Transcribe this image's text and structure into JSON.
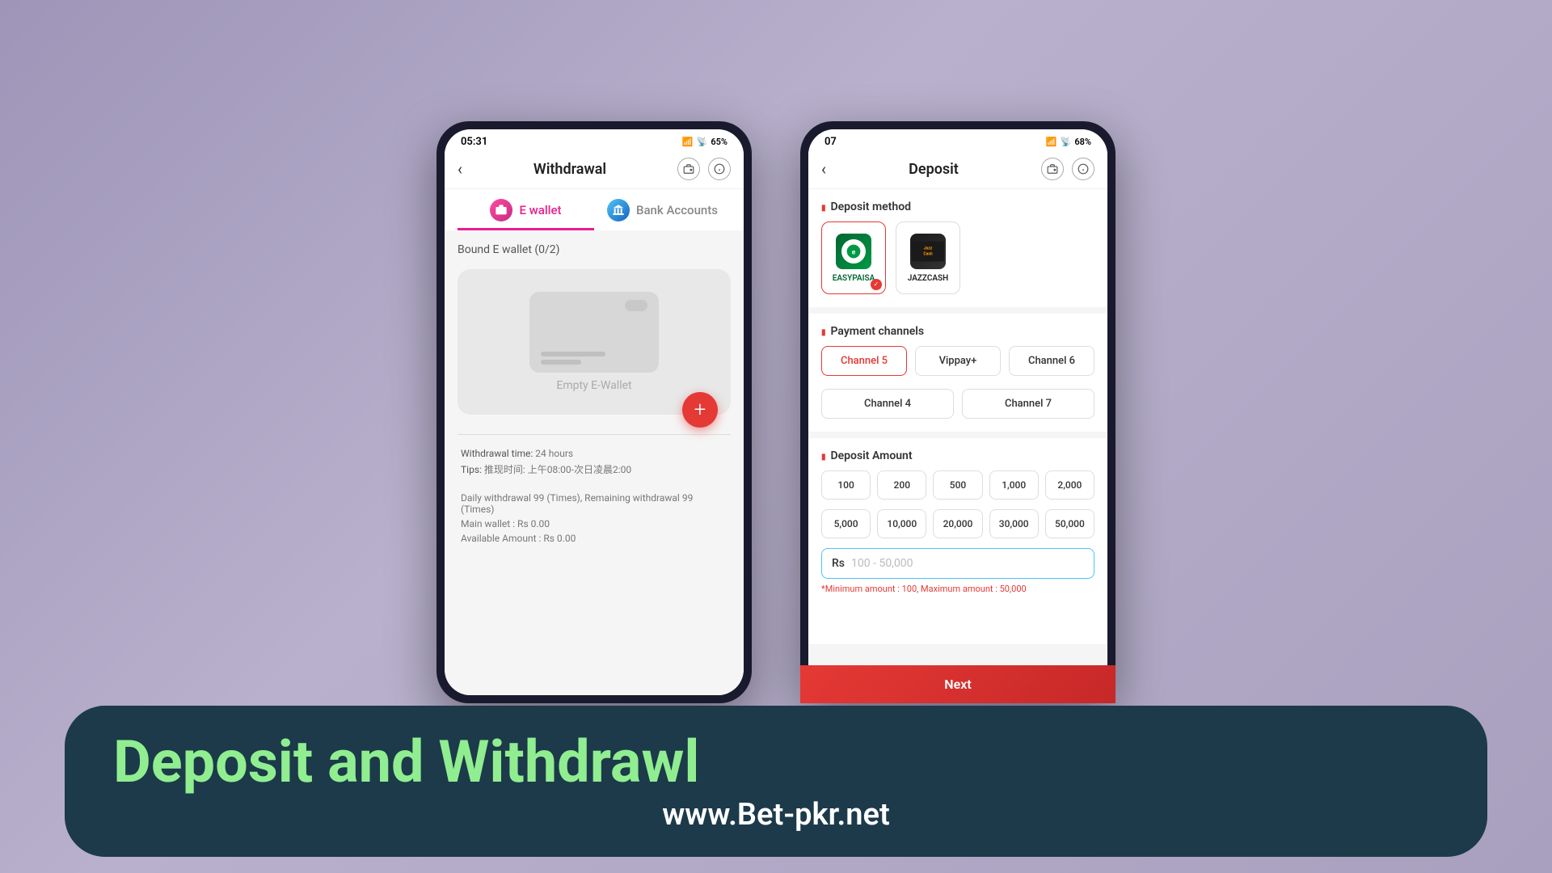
{
  "page": {
    "background_color": "#b0a8c8"
  },
  "phone_left": {
    "status_bar": {
      "time": "05:31",
      "wifi": "WiFi",
      "signal": "Signal",
      "battery": "65%"
    },
    "header": {
      "back_label": "‹",
      "title": "Withdrawal",
      "wallet_icon": "wallet",
      "info_icon": "ℹ"
    },
    "tabs": [
      {
        "id": "ewallet",
        "label": "E wallet",
        "active": true
      },
      {
        "id": "bank",
        "label": "Bank Accounts",
        "active": false
      }
    ],
    "bound_label": "Bound E wallet (0/2)",
    "empty_wallet_text": "Empty E-Wallet",
    "add_button_label": "+",
    "info": {
      "withdrawal_time_label": "Withdrawal time:",
      "withdrawal_time_value": "24 hours",
      "tips_label": "Tips:",
      "tips_value": "推现时间: 上午08:00-次日凌晨2:00",
      "daily_label": "Daily withdrawal 99 (Times), Remaining withdrawal 99 (Times)",
      "main_wallet_label": "Main wallet : Rs 0.00",
      "available_label": "Available Amount : Rs 0.00"
    }
  },
  "phone_right": {
    "status_bar": {
      "time": "07",
      "wifi": "WiFi",
      "signal": "Signal",
      "battery": "68%"
    },
    "header": {
      "back_label": "‹",
      "title": "Deposit",
      "wallet_icon": "wallet",
      "info_icon": "ℹ"
    },
    "deposit_method_title": "Deposit method",
    "payment_methods": [
      {
        "id": "easypaisa",
        "label": "EASYPAISA",
        "selected": true
      },
      {
        "id": "jazzcash",
        "label": "JAZZCASH",
        "selected": false
      }
    ],
    "payment_channels_title": "Payment channels",
    "channels_row1": [
      {
        "id": "ch5",
        "label": "Channel 5",
        "selected": true
      },
      {
        "id": "vippay",
        "label": "Vippay+",
        "selected": false
      },
      {
        "id": "ch6",
        "label": "Channel 6",
        "selected": false
      }
    ],
    "channels_row2": [
      {
        "id": "ch4",
        "label": "Channel 4",
        "selected": false
      },
      {
        "id": "ch7",
        "label": "Channel 7",
        "selected": false
      }
    ],
    "deposit_amount_title": "Deposit Amount",
    "amounts_row1": [
      "100",
      "200",
      "500",
      "1,000",
      "2,000"
    ],
    "amounts_row2": [
      "5,000",
      "10,000",
      "20,000",
      "30,000",
      "50,000"
    ],
    "amount_input": {
      "currency": "Rs",
      "placeholder": "100 - 50,000"
    },
    "min_max_text": "*Minimum amount : 100,  Maximum amount : 50,000",
    "next_button_label": "Next"
  },
  "banner": {
    "title": "Deposit and Withdrawl",
    "url": "www.Bet-pkr.net",
    "background_color": "#1a3a4a"
  }
}
